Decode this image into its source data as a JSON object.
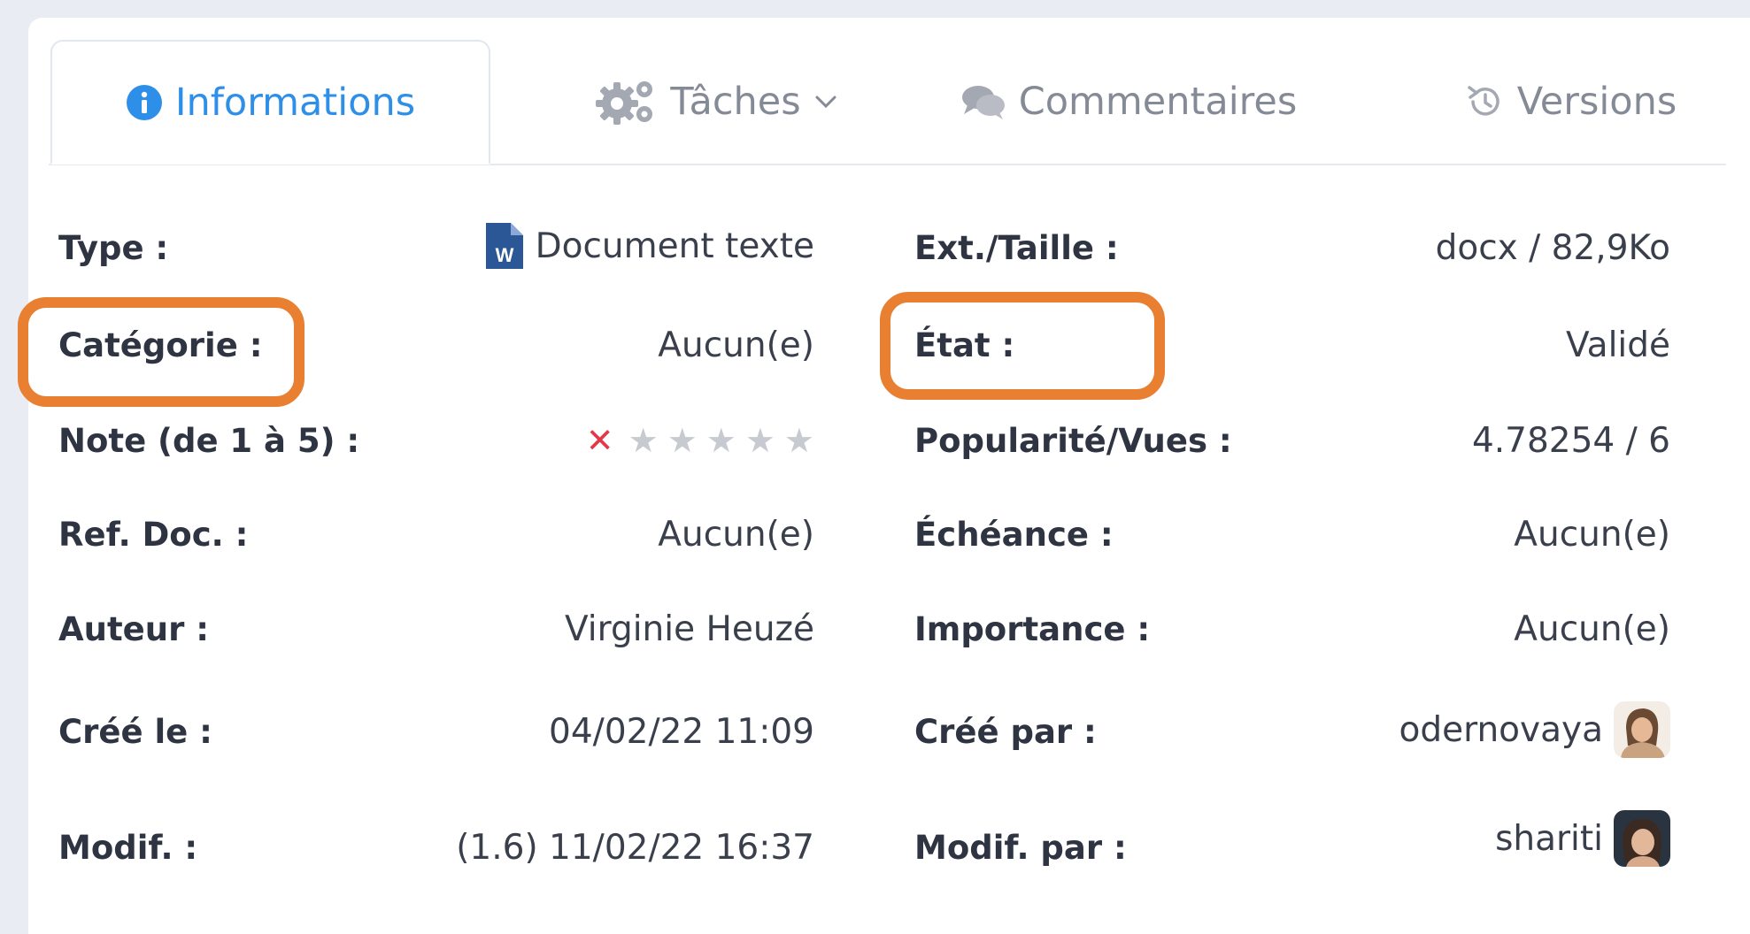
{
  "tabs": [
    {
      "label": "Informations",
      "icon": "info-circle-icon",
      "active": true
    },
    {
      "label": "Tâches",
      "icon": "gears-icon",
      "dropdown": true
    },
    {
      "label": "Commentaires",
      "icon": "comments-icon"
    },
    {
      "label": "Versions",
      "icon": "history-icon"
    }
  ],
  "fields": {
    "type": {
      "label": "Type :",
      "value": "Document texte",
      "icon": "word-document-icon"
    },
    "ext_size": {
      "label": "Ext./Taille :",
      "value": "docx / 82,9Ko"
    },
    "category": {
      "label": "Catégorie :",
      "value": "Aucun(e)"
    },
    "state": {
      "label": "État :",
      "value": "Validé"
    },
    "rating": {
      "label": "Note (de 1 à 5) :",
      "value": 0,
      "max": 5,
      "clear_icon": "x-icon"
    },
    "popularity": {
      "label": "Popularité/Vues :",
      "value": "4.78254 / 6"
    },
    "ref_doc": {
      "label": "Ref. Doc. :",
      "value": "Aucun(e)"
    },
    "due": {
      "label": "Échéance :",
      "value": "Aucun(e)"
    },
    "author": {
      "label": "Auteur :",
      "value": "Virginie Heuzé"
    },
    "importance": {
      "label": "Importance :",
      "value": "Aucun(e)"
    },
    "created": {
      "label": "Créé le :",
      "value": "04/02/22 11:09"
    },
    "created_by": {
      "label": "Créé par :",
      "value": "odernovaya",
      "avatar": "user-avatar"
    },
    "modified": {
      "label": "Modif. :",
      "value": "(1.6) 11/02/22 16:37"
    },
    "modified_by": {
      "label": "Modif. par :",
      "value": "shariti",
      "avatar": "user-avatar"
    }
  },
  "colors": {
    "accent": "#2e8fe8",
    "highlight": "#e97f31",
    "star_empty": "#c7cad1",
    "clear_rating": "#e2384a"
  }
}
